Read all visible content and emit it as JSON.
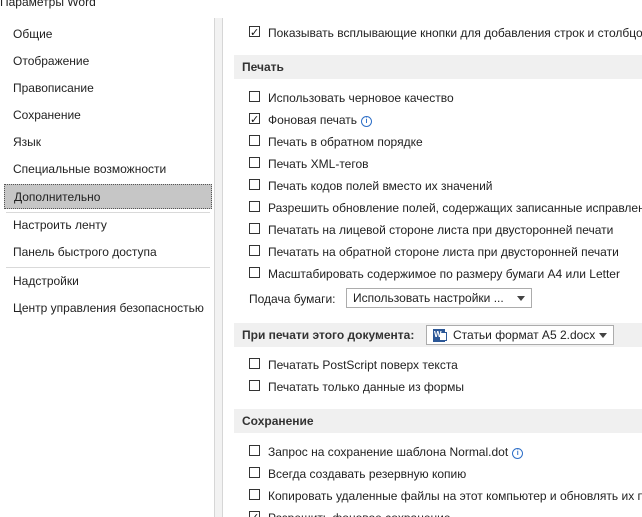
{
  "window": {
    "title": "Параметры Word"
  },
  "sidebar": {
    "items": [
      {
        "label": "Общие"
      },
      {
        "label": "Отображение"
      },
      {
        "label": "Правописание"
      },
      {
        "label": "Сохранение"
      },
      {
        "label": "Язык"
      },
      {
        "label": "Специальные возможности"
      },
      {
        "label": "Дополнительно",
        "active": true
      },
      {
        "label": "Настроить ленту"
      },
      {
        "label": "Панель быстрого доступа"
      },
      {
        "label": "Надстройки"
      },
      {
        "label": "Центр управления безопасностью"
      }
    ]
  },
  "main": {
    "top_option": {
      "label": "Показывать всплывающие кнопки для добавления строк и столбцов",
      "checked": true
    },
    "print_section": {
      "title": "Печать",
      "options": [
        {
          "label": "Использовать черновое качество",
          "checked": false
        },
        {
          "label": "Фоновая печать",
          "checked": true,
          "info": true
        },
        {
          "label": "Печать в обратном порядке",
          "checked": false
        },
        {
          "label": "Печать XML-тегов",
          "checked": false
        },
        {
          "label": "Печать кодов полей вместо их значений",
          "checked": false
        },
        {
          "label": "Разрешить обновление полей, содержащих записанные исправления",
          "checked": false
        },
        {
          "label": "Печатать на лицевой стороне листа при двусторонней печати",
          "checked": false
        },
        {
          "label": "Печатать на обратной стороне листа при двусторонней печати",
          "checked": false
        },
        {
          "label": "Масштабировать содержимое по размеру бумаги A4 или Letter",
          "checked": false
        }
      ],
      "paper_feed": {
        "label": "Подача бумаги:",
        "value": "Использовать настройки ..."
      }
    },
    "doc_print_section": {
      "title": "При печати этого документа:",
      "document": "Статьи формат А5 2.docx",
      "options": [
        {
          "label": "Печатать PostScript поверх текста",
          "checked": false
        },
        {
          "label": "Печатать только данные из формы",
          "checked": false
        }
      ]
    },
    "save_section": {
      "title": "Сохранение",
      "options": [
        {
          "label": "Запрос на сохранение шаблона Normal.dot",
          "checked": false,
          "info": true
        },
        {
          "label": "Всегда создавать резервную копию",
          "checked": false
        },
        {
          "label": "Копировать удаленные файлы на этот компьютер и обновлять их при сохранении",
          "checked": false
        },
        {
          "label": "Разрешить фоновое сохранение",
          "checked": true
        }
      ]
    }
  }
}
